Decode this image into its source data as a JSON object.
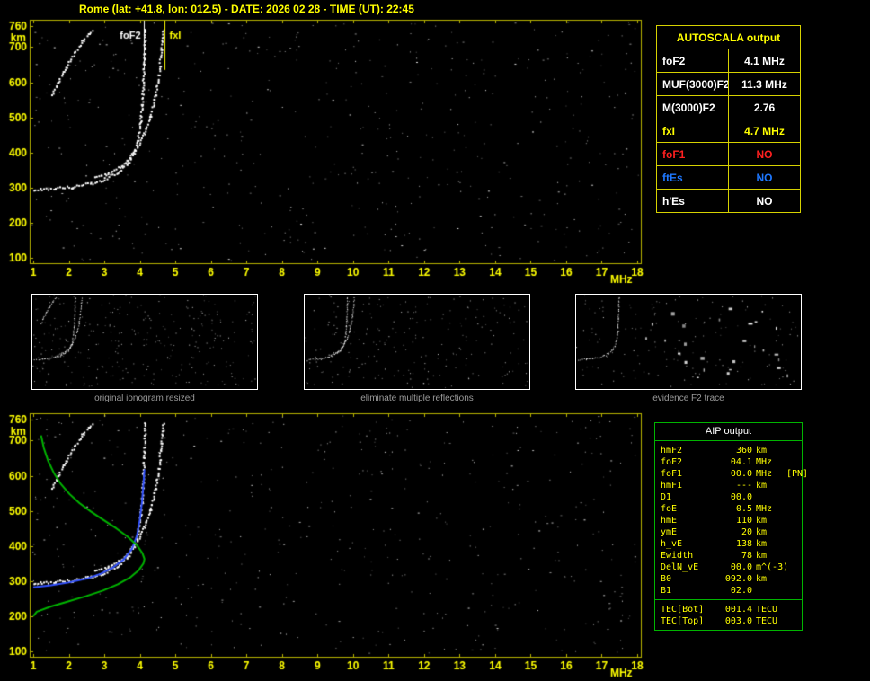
{
  "title": "Rome (lat: +41.8, lon: 012.5) - DATE: 2026 02 28 - TIME (UT): 22:45",
  "autoscala_table": {
    "header": "AUTOSCALA output",
    "rows": [
      {
        "label": "foF2",
        "value": "4.1 MHz",
        "color": "#ffffff"
      },
      {
        "label": "MUF(3000)F2",
        "value": "11.3 MHz",
        "color": "#ffffff"
      },
      {
        "label": "M(3000)F2",
        "value": "2.76",
        "color": "#ffffff"
      },
      {
        "label": "fxI",
        "value": "4.7 MHz",
        "color": "#ffff00"
      },
      {
        "label": "foF1",
        "value": "NO",
        "color": "#ff2020"
      },
      {
        "label": "ftEs",
        "value": "NO",
        "color": "#1e78ff"
      },
      {
        "label": "h'Es",
        "value": "NO",
        "color": "#ffffff"
      }
    ]
  },
  "aip_table": {
    "header": "AIP output",
    "rows": [
      {
        "label": "hmF2",
        "value": "360",
        "unit": "km",
        "extra": ""
      },
      {
        "label": "foF2",
        "value": "04.1",
        "unit": "MHz",
        "extra": ""
      },
      {
        "label": "foF1",
        "value": "00.0",
        "unit": "MHz",
        "extra": "[PN]"
      },
      {
        "label": "hmF1",
        "value": "---",
        "unit": "km",
        "extra": ""
      },
      {
        "label": "D1",
        "value": "00.0",
        "unit": "",
        "extra": ""
      },
      {
        "label": "foE",
        "value": "0.5",
        "unit": "MHz",
        "extra": ""
      },
      {
        "label": "hmE",
        "value": "110",
        "unit": "km",
        "extra": ""
      },
      {
        "label": "ymE",
        "value": "20",
        "unit": "km",
        "extra": ""
      },
      {
        "label": "h_vE",
        "value": "138",
        "unit": "km",
        "extra": ""
      },
      {
        "label": "Ewidth",
        "value": "78",
        "unit": "km",
        "extra": ""
      },
      {
        "label": "DelN_vE",
        "value": "00.0",
        "unit": "m^(-3)",
        "extra": ""
      },
      {
        "label": "B0",
        "value": "092.0",
        "unit": "km",
        "extra": ""
      },
      {
        "label": "B1",
        "value": "02.0",
        "unit": "",
        "extra": ""
      }
    ],
    "tec_rows": [
      {
        "label": "TEC[Bot]",
        "value": "001.4",
        "unit": "TECU",
        "extra": ""
      },
      {
        "label": "TEC[Top]",
        "value": "003.0",
        "unit": "TECU",
        "extra": ""
      }
    ]
  },
  "thumbnails": [
    {
      "caption": "original ionogram resized",
      "series": [
        0,
        1,
        2
      ],
      "noise": 300,
      "seed": 5,
      "clusters": 0
    },
    {
      "caption": "eliminate multiple reflections",
      "series": [
        0,
        1
      ],
      "noise": 220,
      "seed": 9,
      "clusters": 0
    },
    {
      "caption": "evidence F2 trace",
      "series": [
        0
      ],
      "noise": 150,
      "seed": 13,
      "clusters": 28
    }
  ],
  "chart_data": [
    {
      "type": "scatter",
      "title": "Ionogram with Autoscala markers",
      "xlabel": "MHz",
      "ylabel": "km",
      "xlim": [
        1,
        18
      ],
      "ylim": [
        100,
        760
      ],
      "xticks": [
        1,
        2,
        3,
        4,
        5,
        6,
        7,
        8,
        9,
        10,
        11,
        12,
        13,
        14,
        15,
        16,
        17,
        18
      ],
      "yticks": [
        100,
        200,
        300,
        400,
        500,
        600,
        700,
        760
      ],
      "frame_color": "#b8b400",
      "tick_color": "#ffff00",
      "noise": {
        "seed": 11,
        "count": 520
      },
      "markers": [
        {
          "name": "foF2",
          "freq": 4.1,
          "color": "#ffffff",
          "side": "left"
        },
        {
          "name": "fxI",
          "freq": 4.7,
          "color": "#ffff00",
          "side": "right"
        }
      ],
      "series": [
        {
          "name": "F2 ordinary trace",
          "color": "#ffffff",
          "style": "echo",
          "points": [
            [
              1.0,
              296
            ],
            [
              1.6,
              299
            ],
            [
              2.1,
              304
            ],
            [
              2.6,
              313
            ],
            [
              3.0,
              326
            ],
            [
              3.35,
              344
            ],
            [
              3.6,
              366
            ],
            [
              3.8,
              396
            ],
            [
              3.93,
              437
            ],
            [
              4.0,
              487
            ],
            [
              4.05,
              540
            ],
            [
              4.08,
              600
            ],
            [
              4.11,
              668
            ],
            [
              4.14,
              755
            ]
          ]
        },
        {
          "name": "F2 extraordinary trace",
          "color": "#ffffff",
          "style": "echo",
          "points": [
            [
              2.7,
              332
            ],
            [
              3.1,
              342
            ],
            [
              3.45,
              360
            ],
            [
              3.7,
              385
            ],
            [
              3.9,
              415
            ],
            [
              4.1,
              455
            ],
            [
              4.28,
              505
            ],
            [
              4.42,
              562
            ],
            [
              4.52,
              625
            ],
            [
              4.6,
              695
            ],
            [
              4.65,
              752
            ]
          ]
        },
        {
          "name": "second reflection",
          "color": "#ffffff",
          "style": "echo",
          "points": [
            [
              1.5,
              565
            ],
            [
              1.68,
              600
            ],
            [
              1.9,
              640
            ],
            [
              2.15,
              685
            ],
            [
              2.4,
              722
            ],
            [
              2.65,
              752
            ]
          ]
        }
      ]
    },
    {
      "type": "scatter",
      "title": "Ionogram with restored trace and electron density profile",
      "xlabel": "MHz",
      "ylabel": "km",
      "xlim": [
        1,
        18
      ],
      "ylim": [
        100,
        760
      ],
      "xticks": [
        1,
        2,
        3,
        4,
        5,
        6,
        7,
        8,
        9,
        10,
        11,
        12,
        13,
        14,
        15,
        16,
        17,
        18
      ],
      "yticks": [
        100,
        200,
        300,
        400,
        500,
        600,
        700,
        760
      ],
      "frame_color": "#b8b400",
      "tick_color": "#ffff00",
      "noise": {
        "seed": 23,
        "count": 520
      },
      "markers": [],
      "series": [
        {
          "name": "F2 ordinary trace",
          "color": "#ffffff",
          "style": "echo",
          "points": [
            [
              1.0,
              296
            ],
            [
              1.6,
              299
            ],
            [
              2.1,
              304
            ],
            [
              2.6,
              313
            ],
            [
              3.0,
              326
            ],
            [
              3.35,
              344
            ],
            [
              3.6,
              366
            ],
            [
              3.8,
              396
            ],
            [
              3.93,
              437
            ],
            [
              4.0,
              487
            ],
            [
              4.05,
              540
            ],
            [
              4.08,
              600
            ],
            [
              4.11,
              668
            ],
            [
              4.14,
              755
            ]
          ]
        },
        {
          "name": "F2 extraordinary trace",
          "color": "#ffffff",
          "style": "echo",
          "points": [
            [
              2.7,
              332
            ],
            [
              3.1,
              342
            ],
            [
              3.45,
              360
            ],
            [
              3.7,
              385
            ],
            [
              3.9,
              415
            ],
            [
              4.1,
              455
            ],
            [
              4.28,
              505
            ],
            [
              4.42,
              562
            ],
            [
              4.52,
              625
            ],
            [
              4.6,
              695
            ],
            [
              4.65,
              752
            ]
          ]
        },
        {
          "name": "second reflection",
          "color": "#ffffff",
          "style": "echo",
          "points": [
            [
              1.5,
              565
            ],
            [
              1.68,
              600
            ],
            [
              1.9,
              640
            ],
            [
              2.15,
              685
            ],
            [
              2.4,
              722
            ],
            [
              2.65,
              752
            ]
          ]
        },
        {
          "name": "restored F2 trace",
          "color": "#3050ff",
          "style": "line",
          "width": 2,
          "points": [
            [
              1.0,
              282
            ],
            [
              1.5,
              288
            ],
            [
              2.0,
              296
            ],
            [
              2.5,
              307
            ],
            [
              2.9,
              321
            ],
            [
              3.25,
              339
            ],
            [
              3.55,
              362
            ],
            [
              3.78,
              392
            ],
            [
              3.92,
              430
            ],
            [
              4.0,
              475
            ],
            [
              4.06,
              525
            ],
            [
              4.1,
              575
            ],
            [
              4.13,
              618
            ]
          ]
        },
        {
          "name": "electron density profile",
          "color": "#00b400",
          "style": "line",
          "width": 2,
          "points": [
            [
              1.22,
              715
            ],
            [
              1.3,
              678
            ],
            [
              1.42,
              642
            ],
            [
              1.58,
              608
            ],
            [
              1.78,
              576
            ],
            [
              2.02,
              548
            ],
            [
              2.3,
              522
            ],
            [
              2.62,
              498
            ],
            [
              2.98,
              474
            ],
            [
              3.34,
              450
            ],
            [
              3.66,
              426
            ],
            [
              3.92,
              402
            ],
            [
              4.07,
              380
            ],
            [
              4.13,
              363
            ],
            [
              4.1,
              350
            ],
            [
              3.96,
              330
            ],
            [
              3.72,
              310
            ],
            [
              3.38,
              291
            ],
            [
              2.96,
              273
            ],
            [
              2.48,
              257
            ],
            [
              1.98,
              242
            ],
            [
              1.5,
              228
            ],
            [
              1.1,
              213
            ],
            [
              1.0,
              200
            ]
          ]
        }
      ]
    }
  ]
}
